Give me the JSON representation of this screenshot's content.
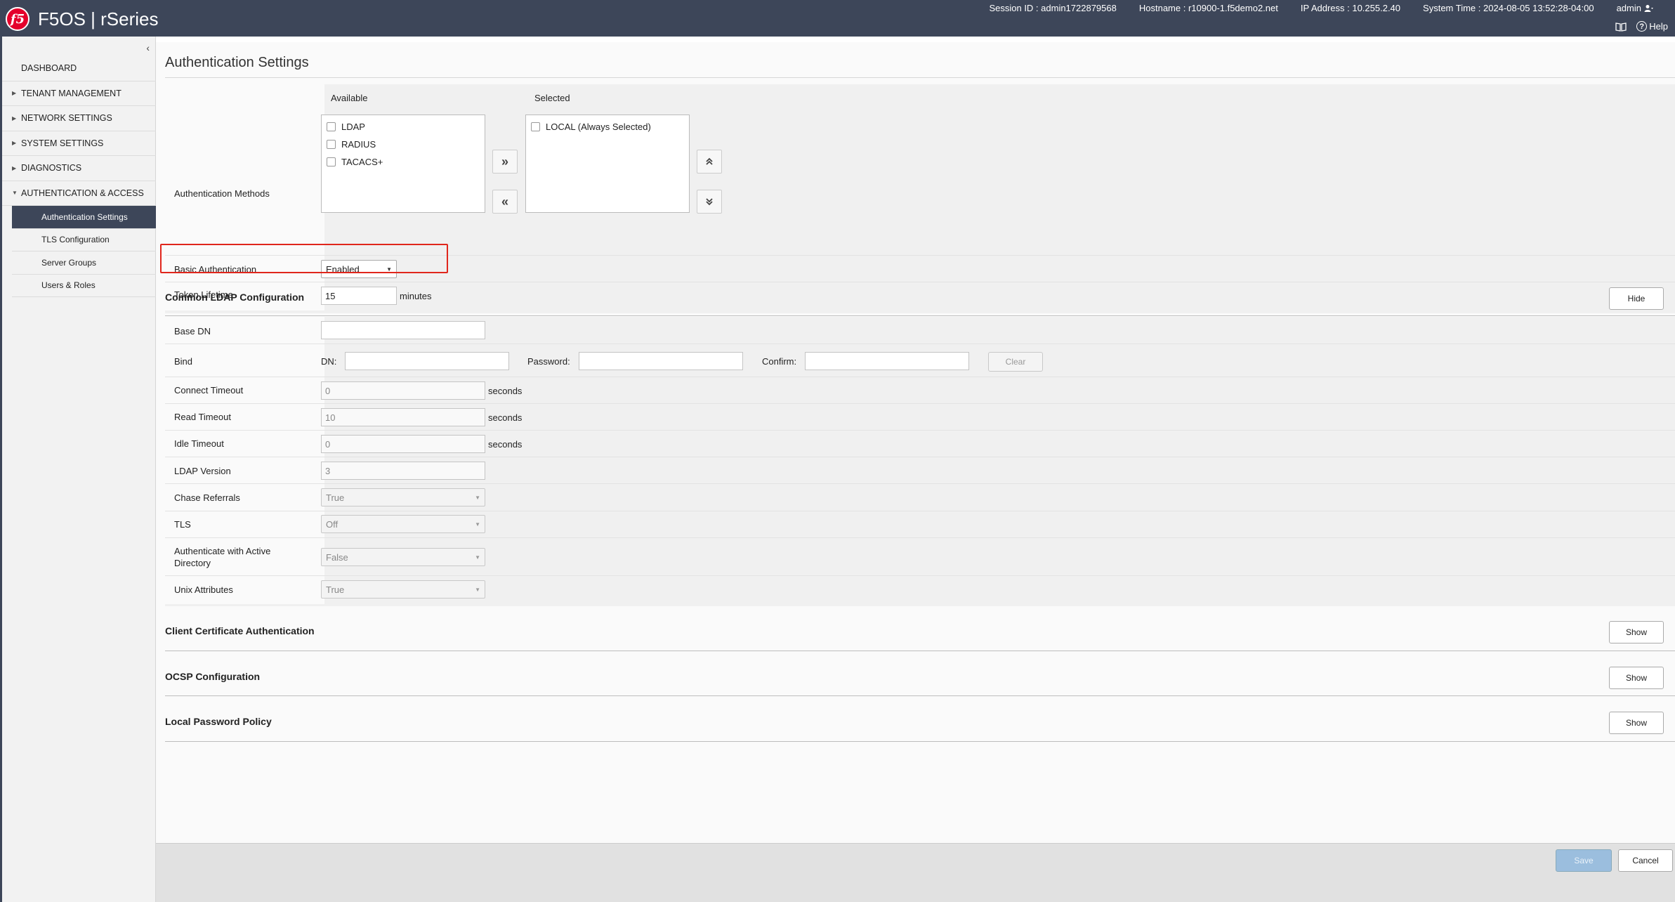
{
  "app": {
    "logo": "f5",
    "title": "F5OS | rSeries"
  },
  "header": {
    "session": "Session ID : admin1722879568",
    "hostname": "Hostname : r10900-1.f5demo2.net",
    "ip": "IP Address : 10.255.2.40",
    "time": "System Time : 2024-08-05 13:52:28-04:00",
    "user": "admin",
    "help": "Help"
  },
  "sidebar": {
    "items": [
      {
        "label": "DASHBOARD"
      },
      {
        "label": "TENANT MANAGEMENT"
      },
      {
        "label": "NETWORK SETTINGS"
      },
      {
        "label": "SYSTEM SETTINGS"
      },
      {
        "label": "DIAGNOSTICS"
      },
      {
        "label": "AUTHENTICATION & ACCESS"
      }
    ],
    "subitems": [
      {
        "label": "Authentication Settings"
      },
      {
        "label": "TLS Configuration"
      },
      {
        "label": "Server Groups"
      },
      {
        "label": "Users & Roles"
      }
    ]
  },
  "page": {
    "title": "Authentication Settings"
  },
  "auth": {
    "methods_label": "Authentication Methods",
    "available_label": "Available",
    "selected_label": "Selected",
    "available": [
      "LDAP",
      "RADIUS",
      "TACACS+"
    ],
    "selected": [
      "LOCAL (Always Selected)"
    ],
    "basic_label": "Basic Authentication",
    "basic_value": "Enabled",
    "token_label": "Token Lifetime",
    "token_value": "15",
    "token_unit": "minutes"
  },
  "ldap": {
    "title": "Common LDAP Configuration",
    "hide": "Hide",
    "base_dn_label": "Base DN",
    "base_dn_value": "",
    "bind_label": "Bind",
    "dn_label": "DN:",
    "password_label": "Password:",
    "confirm_label": "Confirm:",
    "clear": "Clear",
    "connect_label": "Connect Timeout",
    "connect_value": "0",
    "read_label": "Read Timeout",
    "read_value": "10",
    "idle_label": "Idle Timeout",
    "idle_value": "0",
    "seconds": "seconds",
    "version_label": "LDAP Version",
    "version_value": "3",
    "chase_label": "Chase Referrals",
    "chase_value": "True",
    "tls_label": "TLS",
    "tls_value": "Off",
    "ad_label": "Authenticate with Active Directory",
    "ad_value": "False",
    "unix_label": "Unix Attributes",
    "unix_value": "True"
  },
  "sections": [
    {
      "title": "Client Certificate Authentication",
      "button": "Show"
    },
    {
      "title": "OCSP Configuration",
      "button": "Show"
    },
    {
      "title": "Local Password Policy",
      "button": "Show"
    }
  ],
  "footer": {
    "save": "Save",
    "cancel": "Cancel"
  },
  "colors": {
    "header": "#3d4659",
    "highlight": "#e0261c",
    "save": "#9bbede"
  }
}
